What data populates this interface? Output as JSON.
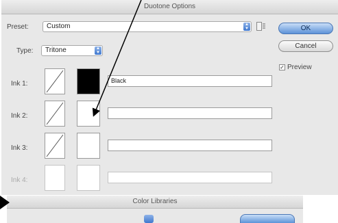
{
  "duotone_dialog": {
    "title": "Duotone Options",
    "preset_label": "Preset:",
    "preset_value": "Custom",
    "type_label": "Type:",
    "type_value": "Tritone",
    "ok_label": "OK",
    "cancel_label": "Cancel",
    "preview_label": "Preview",
    "preview_checked": true,
    "inks": [
      {
        "label": "Ink 1:",
        "name": "Black",
        "swatch_color": "#000000",
        "enabled": true
      },
      {
        "label": "Ink 2:",
        "name": "",
        "swatch_color": "#ffffff",
        "enabled": true
      },
      {
        "label": "Ink 3:",
        "name": "",
        "swatch_color": "#ffffff",
        "enabled": true
      },
      {
        "label": "Ink 4:",
        "name": "",
        "swatch_color": "#ffffff",
        "enabled": false
      }
    ]
  },
  "color_libraries_dialog": {
    "title": "Color Libraries"
  },
  "colors": {
    "dialog_bg": "#e8e8e8",
    "default_button": "#5c93d8"
  }
}
